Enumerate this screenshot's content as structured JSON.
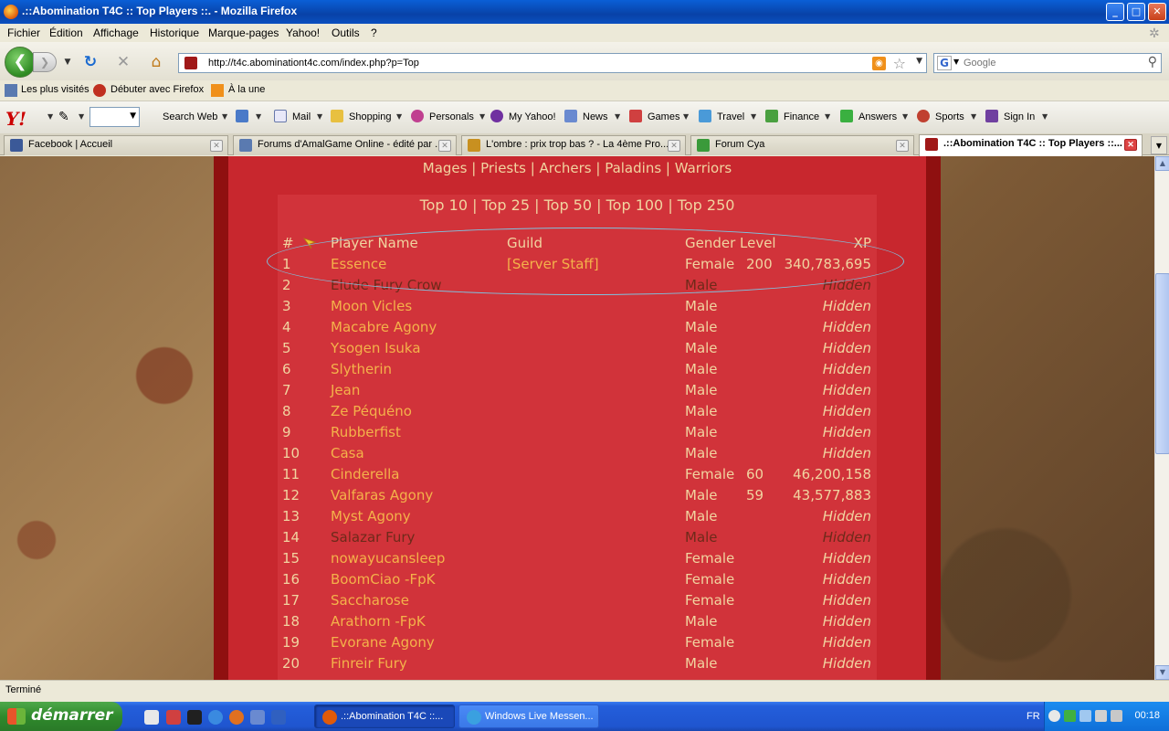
{
  "window": {
    "title": ".::Abomination T4C :: Top Players ::. - Mozilla Firefox",
    "min": "_",
    "max": "□",
    "close": "✕"
  },
  "menu": [
    "Fichier",
    "Édition",
    "Affichage",
    "Historique",
    "Marque-pages",
    "Yahoo!",
    "Outils",
    "?"
  ],
  "navigation": {
    "back": "❮",
    "forward": "❯",
    "url": "http://t4c.abominationt4c.com/index.php?p=Top",
    "search_placeholder": "Google",
    "search_engine": "G"
  },
  "bookmarks": [
    "Les plus visités",
    "Débuter avec Firefox",
    "À la une"
  ],
  "yahoo_toolbar": {
    "logo": "Y!",
    "items": [
      "Search Web",
      "Mail",
      "Shopping",
      "Personals",
      "My Yahoo!",
      "News",
      "Games",
      "Travel",
      "Finance",
      "Answers",
      "Sports",
      "Sign In"
    ]
  },
  "tabs": [
    {
      "label": "Facebook | Accueil",
      "icon": "facebook-icon",
      "color": "#3b5998"
    },
    {
      "label": "Forums d'AmalGame Online - édité par ...",
      "icon": "forum-icon",
      "color": "#5a7ab0"
    },
    {
      "label": "L'ombre : prix trop bas ? - La 4ème Pro...",
      "icon": "page-icon",
      "color": "#c89020"
    },
    {
      "label": "Forum Cya",
      "icon": "chat-icon",
      "color": "#3a9a3a"
    },
    {
      "label": ".::Abomination T4C :: Top Players ::...",
      "icon": "abomination-icon",
      "color": "#a01818"
    }
  ],
  "page": {
    "classes": [
      "Mages",
      "Priests",
      "Archers",
      "Paladins",
      "Warriors"
    ],
    "top_links": [
      "Top 10",
      "Top 25",
      "Top 50",
      "Top 100",
      "Top 250"
    ],
    "headers": {
      "rank": "#",
      "name": "Player Name",
      "guild": "Guild",
      "gender": "Gender",
      "level": "Level",
      "xp": "XP"
    },
    "players": [
      {
        "rank": "1",
        "name": "Essence",
        "guild": "[Server Staff]",
        "gender": "Female",
        "level": "200",
        "xp": "340,783,695",
        "dim": false
      },
      {
        "rank": "2",
        "name": "Elude Fury Crow",
        "guild": "",
        "gender": "Male",
        "level": "",
        "xp": "Hidden",
        "dim": true
      },
      {
        "rank": "3",
        "name": "Moon Vicles",
        "guild": "",
        "gender": "Male",
        "level": "",
        "xp": "Hidden",
        "dim": false
      },
      {
        "rank": "4",
        "name": "Macabre Agony",
        "guild": "",
        "gender": "Male",
        "level": "",
        "xp": "Hidden",
        "dim": false
      },
      {
        "rank": "5",
        "name": "Ysogen Isuka",
        "guild": "",
        "gender": "Male",
        "level": "",
        "xp": "Hidden",
        "dim": false
      },
      {
        "rank": "6",
        "name": "Slytherin",
        "guild": "",
        "gender": "Male",
        "level": "",
        "xp": "Hidden",
        "dim": false
      },
      {
        "rank": "7",
        "name": "Jean",
        "guild": "",
        "gender": "Male",
        "level": "",
        "xp": "Hidden",
        "dim": false
      },
      {
        "rank": "8",
        "name": "Ze Péquéno",
        "guild": "",
        "gender": "Male",
        "level": "",
        "xp": "Hidden",
        "dim": false
      },
      {
        "rank": "9",
        "name": "Rubberfist",
        "guild": "",
        "gender": "Male",
        "level": "",
        "xp": "Hidden",
        "dim": false
      },
      {
        "rank": "10",
        "name": "Casa",
        "guild": "",
        "gender": "Male",
        "level": "",
        "xp": "Hidden",
        "dim": false
      },
      {
        "rank": "11",
        "name": "Cinderella",
        "guild": "",
        "gender": "Female",
        "level": "60",
        "xp": "46,200,158",
        "dim": false
      },
      {
        "rank": "12",
        "name": "Valfaras Agony",
        "guild": "",
        "gender": "Male",
        "level": "59",
        "xp": "43,577,883",
        "dim": false
      },
      {
        "rank": "13",
        "name": "Myst Agony",
        "guild": "",
        "gender": "Male",
        "level": "",
        "xp": "Hidden",
        "dim": false
      },
      {
        "rank": "14",
        "name": "Salazar Fury",
        "guild": "",
        "gender": "Male",
        "level": "",
        "xp": "Hidden",
        "dim": true
      },
      {
        "rank": "15",
        "name": "nowayucansleep",
        "guild": "",
        "gender": "Female",
        "level": "",
        "xp": "Hidden",
        "dim": false
      },
      {
        "rank": "16",
        "name": "BoomCiao -FpK",
        "guild": "",
        "gender": "Female",
        "level": "",
        "xp": "Hidden",
        "dim": false
      },
      {
        "rank": "17",
        "name": "Saccharose",
        "guild": "",
        "gender": "Female",
        "level": "",
        "xp": "Hidden",
        "dim": false
      },
      {
        "rank": "18",
        "name": "Arathorn -FpK",
        "guild": "",
        "gender": "Male",
        "level": "",
        "xp": "Hidden",
        "dim": false
      },
      {
        "rank": "19",
        "name": "Evorane Agony",
        "guild": "",
        "gender": "Female",
        "level": "",
        "xp": "Hidden",
        "dim": false
      },
      {
        "rank": "20",
        "name": "Finreir Fury",
        "guild": "",
        "gender": "Male",
        "level": "",
        "xp": "Hidden",
        "dim": false
      }
    ]
  },
  "status": "Terminé",
  "taskbar": {
    "start": "démarrer",
    "items": [
      {
        "label": ".::Abomination T4C ::...",
        "active": true,
        "color": "#e05a0a"
      },
      {
        "label": "Windows Live Messen...",
        "active": false,
        "color": "#3aa0e0"
      }
    ],
    "lang": "FR",
    "clock": "00:18"
  }
}
